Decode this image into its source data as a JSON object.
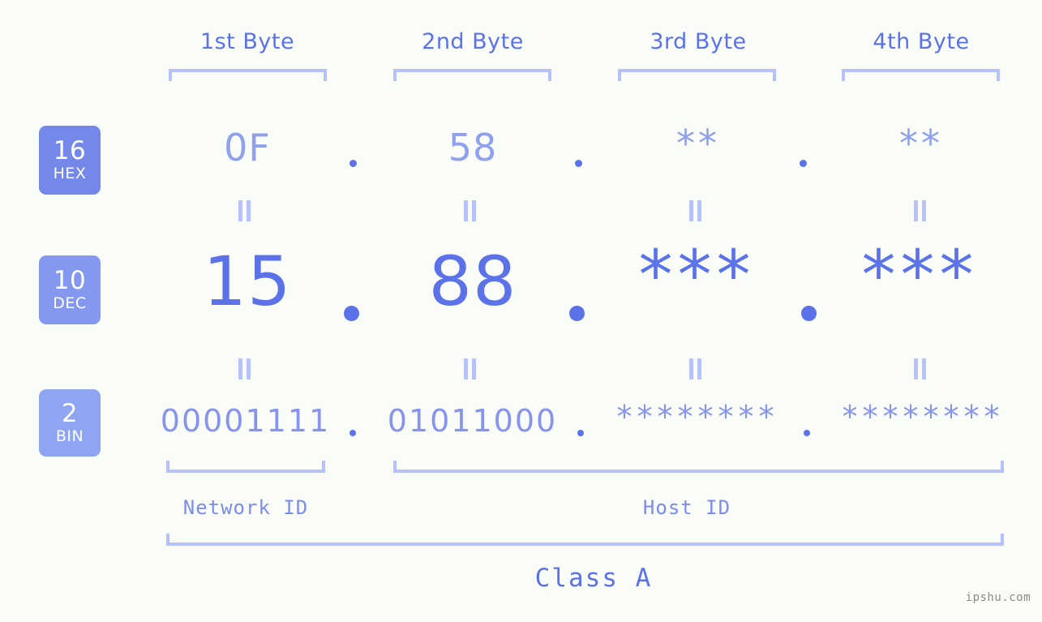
{
  "background_color": "#fafcf7",
  "accent_colors": {
    "strong_blue": "#5b72e8",
    "mid_blue": "#8794ee",
    "light_blue": "#8fa0ec",
    "bracket": "#b6c0fa",
    "hex_badge": "#7388e8",
    "dec_badge": "#8498f0",
    "bin_badge": "#8fa5f2",
    "watermark_gray": "#8a8a8a"
  },
  "header": {
    "bytes": [
      {
        "label": "1st Byte"
      },
      {
        "label": "2nd Byte"
      },
      {
        "label": "3rd Byte"
      },
      {
        "label": "4th Byte"
      }
    ]
  },
  "radix_badges": [
    {
      "number": "16",
      "name": "HEX",
      "color": "#7388e8"
    },
    {
      "number": "10",
      "name": "DEC",
      "color": "#8498f0"
    },
    {
      "number": "2",
      "name": "BIN",
      "color": "#8fa5f2"
    }
  ],
  "rows": {
    "hex": {
      "values": [
        "0F",
        "58",
        "**",
        "**"
      ],
      "separator": "."
    },
    "dec": {
      "values": [
        "15",
        "88",
        "***",
        "***"
      ],
      "separator": "."
    },
    "bin": {
      "values": [
        "00001111",
        "01011000",
        "********",
        "********"
      ],
      "separator": "."
    }
  },
  "equality_marks": {
    "symbol": "=",
    "rows": 2,
    "columns": 4
  },
  "footer": {
    "network_id_label": "Network ID",
    "host_id_label": "Host ID",
    "class_label": "Class A"
  },
  "watermark": {
    "text": "ipshu.com"
  }
}
